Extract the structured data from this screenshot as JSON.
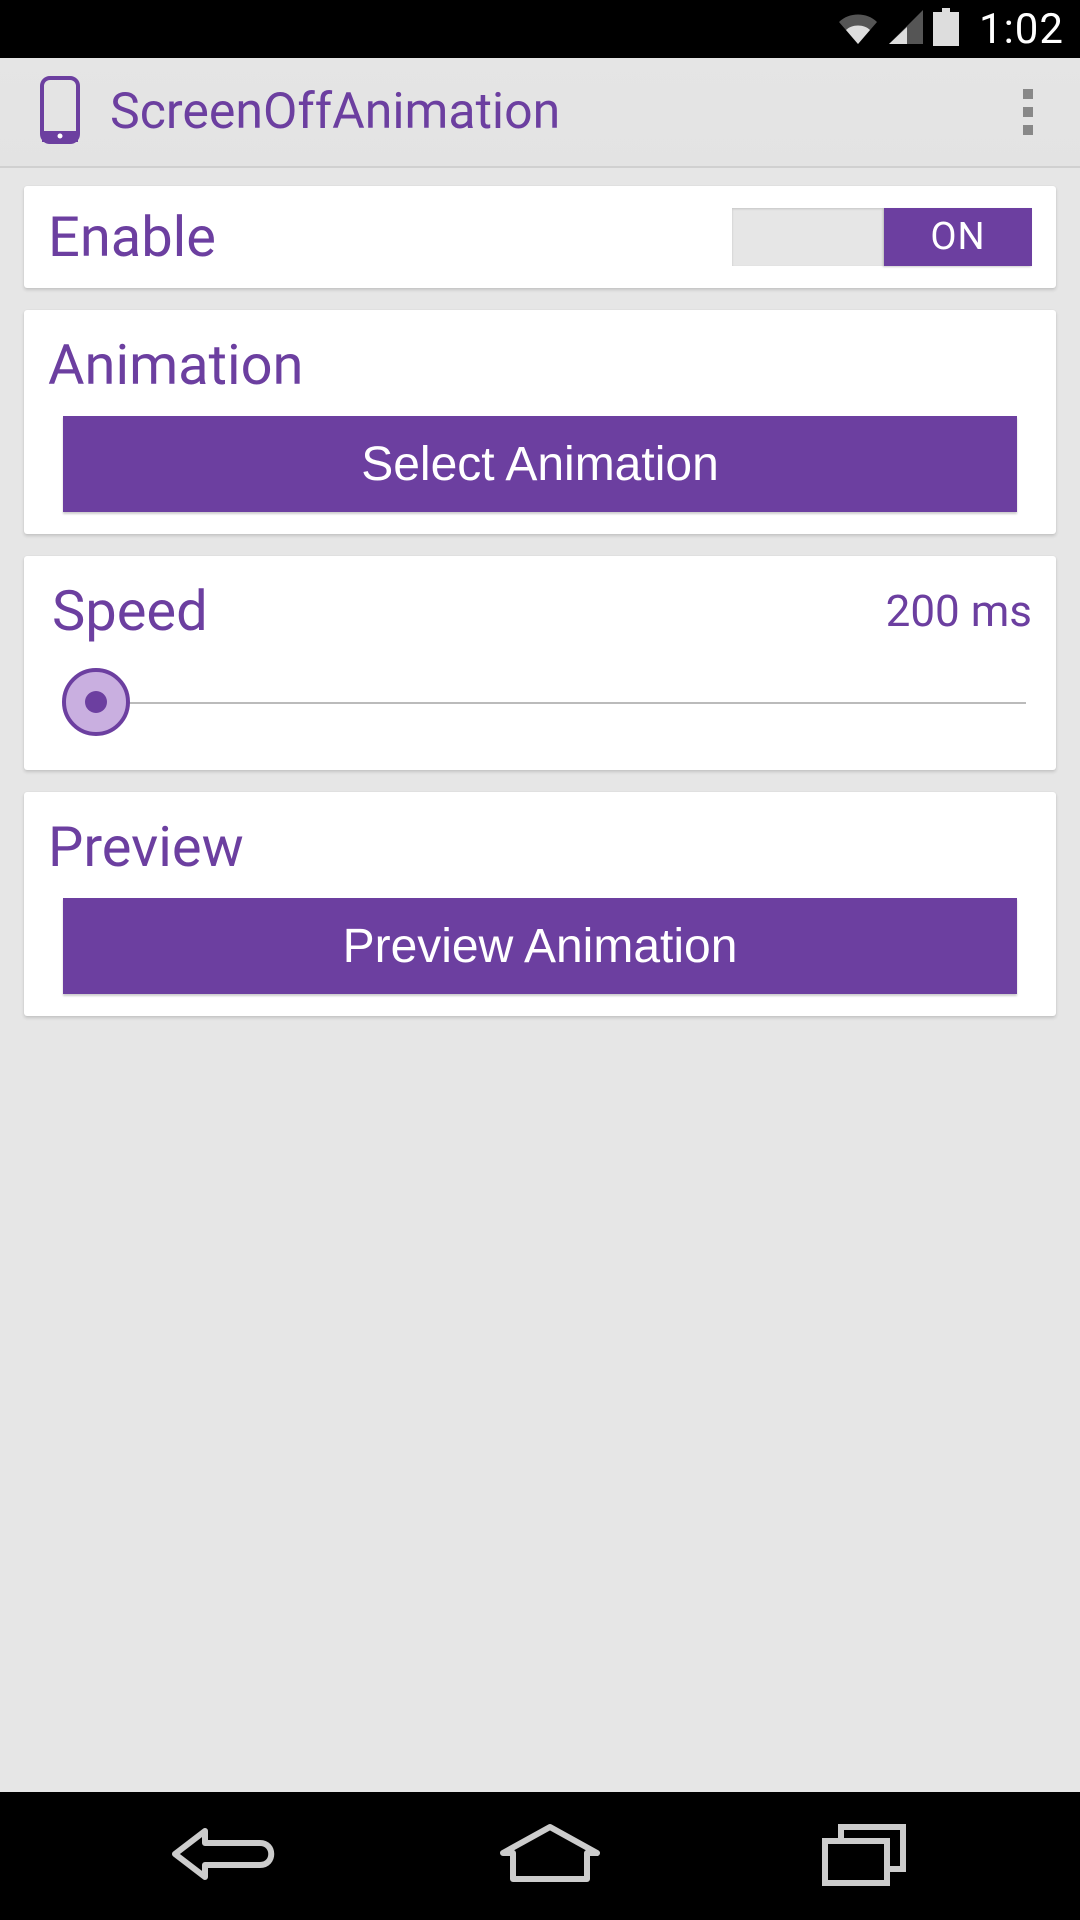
{
  "status": {
    "time": "1:02"
  },
  "header": {
    "title": "ScreenOffAnimation"
  },
  "enable": {
    "label": "Enable",
    "toggle_state": "ON"
  },
  "animation": {
    "title": "Animation",
    "button": "Select Animation"
  },
  "speed": {
    "title": "Speed",
    "value": "200 ms",
    "position_percent": 2
  },
  "preview": {
    "title": "Preview",
    "button": "Preview Animation"
  },
  "colors": {
    "primary": "#6c3fa0",
    "background": "#e6e6e6"
  }
}
